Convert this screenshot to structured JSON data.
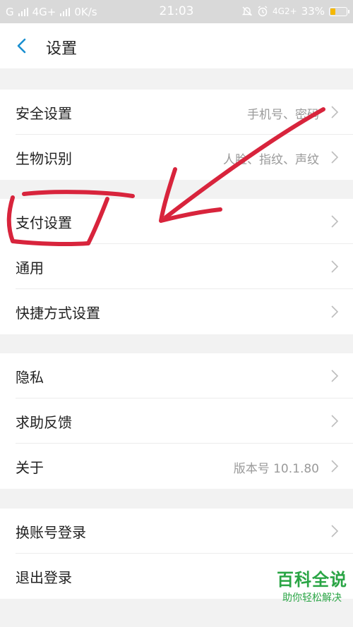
{
  "status_bar": {
    "left_carrier": "G",
    "network": "4G+",
    "speed": "0K/s",
    "time": "21:03",
    "right_network": "4G2+",
    "battery": "33%",
    "battery_level": 0.33,
    "accent": "#f5b800"
  },
  "header": {
    "title": "设置",
    "back_icon": "chevron-left-icon",
    "accent": "#1a8fd0"
  },
  "groups": [
    {
      "items": [
        {
          "label": "安全设置",
          "value": "手机号、密码"
        },
        {
          "label": "生物识别",
          "value": "人脸、指纹、声纹"
        }
      ]
    },
    {
      "items": [
        {
          "label": "支付设置",
          "value": ""
        },
        {
          "label": "通用",
          "value": ""
        },
        {
          "label": "快捷方式设置",
          "value": ""
        }
      ]
    },
    {
      "items": [
        {
          "label": "隐私",
          "value": ""
        },
        {
          "label": "求助反馈",
          "value": ""
        },
        {
          "label": "关于",
          "value": "版本号 10.1.80"
        }
      ]
    },
    {
      "items": [
        {
          "label": "换账号登录",
          "value": ""
        },
        {
          "label": "退出登录",
          "value": ""
        }
      ]
    }
  ],
  "annotation_color": "#d8243c",
  "watermark": {
    "title": "百科全说",
    "subtitle": "助你轻松解决",
    "color": "#2aa545"
  }
}
